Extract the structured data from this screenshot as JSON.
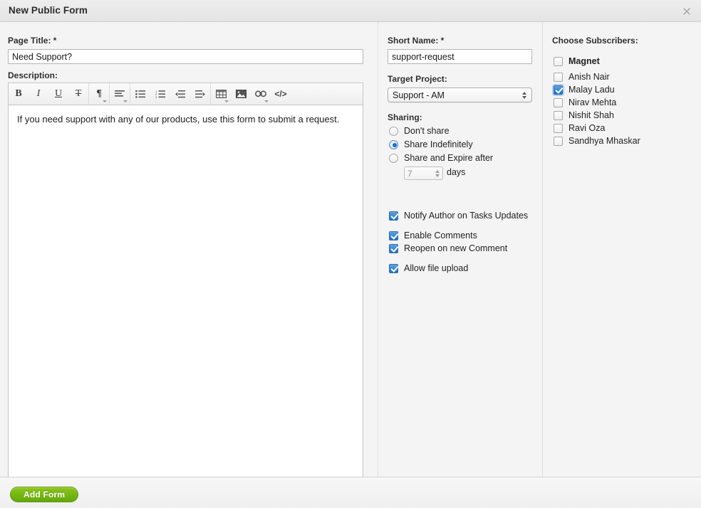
{
  "dialog": {
    "title": "New Public Form",
    "close_icon": "close-x-icon"
  },
  "left_column": {
    "page_title_label": "Page Title: *",
    "page_title_value": "Need Support?",
    "page_title_placeholder": "",
    "description_label": "Description:",
    "description_value": "If you need support with any of our products, use this form to submit a request.",
    "description_placeholder": "",
    "toolbar": [
      {
        "name": "bold",
        "glyph": "B",
        "caret": false
      },
      {
        "name": "italic",
        "glyph": "I",
        "caret": false
      },
      {
        "name": "underline",
        "glyph": "U",
        "caret": false
      },
      {
        "name": "strikethrough",
        "glyph": "S",
        "caret": false
      },
      {
        "name": "paragraph",
        "glyph": "¶",
        "caret": true
      },
      {
        "name": "align",
        "glyph": "align",
        "caret": true
      },
      {
        "name": "bullet-list",
        "glyph": "ul",
        "caret": false
      },
      {
        "name": "numbered-list",
        "glyph": "ol",
        "caret": false
      },
      {
        "name": "outdent",
        "glyph": "outdent",
        "caret": false
      },
      {
        "name": "indent",
        "glyph": "indent",
        "caret": false
      },
      {
        "name": "table",
        "glyph": "table",
        "caret": true
      },
      {
        "name": "image",
        "glyph": "image",
        "caret": false
      },
      {
        "name": "link",
        "glyph": "link",
        "caret": true
      },
      {
        "name": "code",
        "glyph": "</>",
        "caret": false
      }
    ]
  },
  "mid_column": {
    "short_name_label": "Short Name: *",
    "short_name_value": "support-request",
    "short_name_placeholder": "",
    "target_project_label": "Target Project:",
    "target_project_value": "Support - AM",
    "sharing_label": "Sharing:",
    "sharing_options": [
      {
        "label": "Don't share",
        "checked": false
      },
      {
        "label": "Share Indefinitely",
        "checked": true
      },
      {
        "label": "Share and Expire after",
        "checked": false
      }
    ],
    "days_value": "7",
    "days_unit": "days",
    "checkboxes": [
      {
        "label": "Notify Author on Tasks Updates",
        "checked": true
      },
      {
        "label": "Enable Comments",
        "checked": true
      },
      {
        "label": "Reopen on new Comment",
        "checked": true
      },
      {
        "label": "Allow file upload",
        "checked": true
      }
    ]
  },
  "right_column": {
    "subscribers_label": "Choose Subscribers:",
    "subscribers": [
      {
        "label": "Magnet",
        "checked": false,
        "group": true
      },
      {
        "label": "Anish Nair",
        "checked": false,
        "group": false
      },
      {
        "label": "Malay Ladu",
        "checked": true,
        "group": false
      },
      {
        "label": "Nirav Mehta",
        "checked": false,
        "group": false
      },
      {
        "label": "Nishit Shah",
        "checked": false,
        "group": false
      },
      {
        "label": "Ravi Oza",
        "checked": false,
        "group": false
      },
      {
        "label": "Sandhya Mhaskar",
        "checked": false,
        "group": false
      }
    ]
  },
  "footer": {
    "add_form_label": "Add Form"
  },
  "colors": {
    "accent_green": "#74b80f",
    "checkbox_blue": "#1f6fc4",
    "header_bg": "#e7e7e7",
    "body_bg": "#f4f4f4"
  }
}
